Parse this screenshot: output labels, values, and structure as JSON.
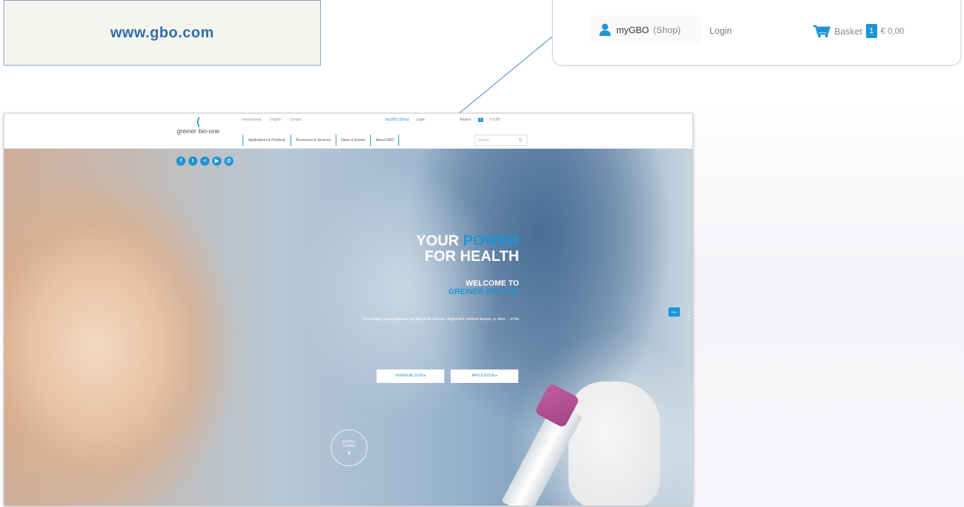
{
  "url_label": "www.gbo.com",
  "zoom": {
    "mygbo": "myGBO",
    "shop": "(Shop)",
    "login": "Login",
    "basket": "Basket",
    "basket_count": "1",
    "price": "€ 0,00"
  },
  "site": {
    "logo_text": "greiner bio-one",
    "top_links": [
      "International",
      "English",
      "Contact"
    ],
    "account": {
      "mygbo": "myGBO (Shop)",
      "login": "Login",
      "basket": "Basket",
      "count": "1",
      "price": "€ 0,00"
    },
    "nav": [
      "Applications & Products",
      "Resources & Services",
      "News & Events",
      "About GBO"
    ],
    "search_placeholder": "Search",
    "headline": {
      "line1a": "YOUR ",
      "line1b": "POWER",
      "line2": "FOR HEALTH"
    },
    "welcome": {
      "line1": "WELCOME TO",
      "line2": "GREINER BIO-ONE"
    },
    "subtext": "Your leading, global partner in the field of life science, diagnostics, medical devices, or other ... of the",
    "cta1": "VENEPUNCTION ▸",
    "cta2": "APPLICATION ▸",
    "scroll": {
      "line1": "SCROLL",
      "line2": "DOWN"
    },
    "side_tab": "Get",
    "social_icons": [
      "facebook-icon",
      "twitter-icon",
      "share-icon",
      "youtube-icon",
      "email-icon"
    ]
  },
  "colors": {
    "accent": "#1f94d4",
    "url_text": "#2e6fad"
  }
}
